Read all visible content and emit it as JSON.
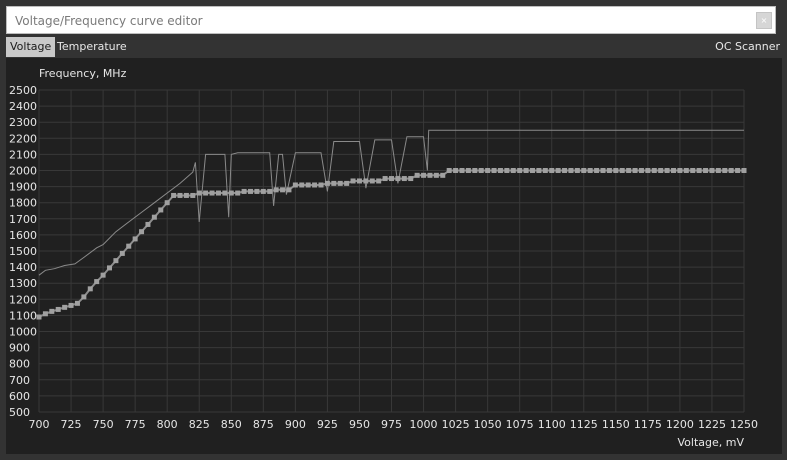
{
  "window": {
    "title": "Voltage/Frequency curve editor",
    "close_glyph": "×"
  },
  "tabs": [
    {
      "label": "Voltage",
      "active": true
    },
    {
      "label": "Temperature",
      "active": false
    }
  ],
  "oc_scanner_label": "OC Scanner",
  "colors": {
    "background": "#333333",
    "plot_background": "#202020",
    "grid": "#383838",
    "upper_curve": "#8a8a8a",
    "main_curve": "#8c8c8c",
    "point_marker": "#a0a0a0"
  },
  "chart_data": {
    "type": "line",
    "ylabel": "Frequency, MHz",
    "xlabel": "Voltage, mV",
    "xlim": [
      700,
      1250
    ],
    "ylim": [
      500,
      2500
    ],
    "x_ticks": [
      700,
      725,
      750,
      775,
      800,
      825,
      850,
      875,
      900,
      925,
      950,
      975,
      1000,
      1025,
      1050,
      1075,
      1100,
      1125,
      1150,
      1175,
      1200,
      1225,
      1250
    ],
    "y_ticks": [
      500,
      600,
      700,
      800,
      900,
      1000,
      1100,
      1200,
      1300,
      1400,
      1500,
      1600,
      1700,
      1800,
      1900,
      2000,
      2100,
      2200,
      2300,
      2400,
      2500
    ],
    "grid": true,
    "series": [
      {
        "role": "upper",
        "x": [
          700,
          705,
          712,
          720,
          728,
          735,
          745,
          750,
          755,
          760,
          770,
          780,
          790,
          800,
          810,
          820,
          822,
          825,
          830,
          840,
          845,
          848,
          850,
          855,
          860,
          870,
          875,
          880,
          883,
          887,
          890,
          893,
          900,
          905,
          912,
          920,
          925,
          930,
          937,
          945,
          950,
          955,
          962,
          970,
          975,
          980,
          987,
          995,
          1000,
          1003,
          1004,
          1010,
          1050,
          1100,
          1150,
          1200,
          1250
        ],
        "y": [
          1350,
          1380,
          1390,
          1410,
          1420,
          1460,
          1520,
          1540,
          1580,
          1620,
          1680,
          1740,
          1800,
          1860,
          1920,
          1990,
          2050,
          1680,
          2100,
          2100,
          2100,
          1710,
          2100,
          2110,
          2110,
          2110,
          2110,
          2110,
          1780,
          2100,
          2100,
          1850,
          2110,
          2110,
          2110,
          2110,
          1870,
          2180,
          2180,
          2180,
          2180,
          1890,
          2190,
          2190,
          2190,
          1920,
          2210,
          2210,
          2210,
          2000,
          2250,
          2250,
          2250,
          2250,
          2250,
          2250,
          2250
        ]
      },
      {
        "role": "main",
        "marker": "square",
        "x": [
          700,
          705,
          710,
          715,
          720,
          725,
          730,
          735,
          740,
          745,
          750,
          755,
          760,
          765,
          770,
          775,
          780,
          785,
          790,
          795,
          800,
          805,
          810,
          815,
          820,
          825,
          830,
          835,
          840,
          845,
          850,
          855,
          860,
          865,
          870,
          875,
          880,
          885,
          890,
          895,
          900,
          905,
          910,
          915,
          920,
          925,
          930,
          935,
          940,
          945,
          950,
          955,
          960,
          965,
          970,
          975,
          980,
          985,
          990,
          995,
          1000,
          1005,
          1010,
          1015,
          1020,
          1025,
          1030,
          1035,
          1040,
          1045,
          1050,
          1055,
          1060,
          1065,
          1070,
          1075,
          1080,
          1085,
          1090,
          1095,
          1100,
          1105,
          1110,
          1115,
          1120,
          1125,
          1130,
          1135,
          1140,
          1145,
          1150,
          1155,
          1160,
          1165,
          1170,
          1175,
          1180,
          1185,
          1190,
          1195,
          1200,
          1205,
          1210,
          1215,
          1220,
          1225,
          1230,
          1235,
          1240,
          1245,
          1250
        ],
        "y": [
          1090,
          1110,
          1125,
          1137,
          1150,
          1162,
          1175,
          1215,
          1265,
          1310,
          1350,
          1395,
          1440,
          1485,
          1530,
          1575,
          1620,
          1665,
          1710,
          1755,
          1800,
          1845,
          1845,
          1845,
          1845,
          1860,
          1860,
          1860,
          1860,
          1860,
          1860,
          1860,
          1870,
          1870,
          1870,
          1870,
          1870,
          1880,
          1880,
          1880,
          1910,
          1910,
          1910,
          1910,
          1910,
          1920,
          1920,
          1920,
          1920,
          1935,
          1935,
          1935,
          1935,
          1935,
          1950,
          1950,
          1950,
          1950,
          1950,
          1970,
          1970,
          1970,
          1970,
          1970,
          2000,
          2000,
          2000,
          2000,
          2000,
          2000,
          2000,
          2000,
          2000,
          2000,
          2000,
          2000,
          2000,
          2000,
          2000,
          2000,
          2000,
          2000,
          2000,
          2000,
          2000,
          2000,
          2000,
          2000,
          2000,
          2000,
          2000,
          2000,
          2000,
          2000,
          2000,
          2000,
          2000,
          2000,
          2000,
          2000,
          2000,
          2000,
          2000,
          2000,
          2000,
          2000,
          2000,
          2000,
          2000,
          2000,
          2000
        ]
      }
    ]
  }
}
